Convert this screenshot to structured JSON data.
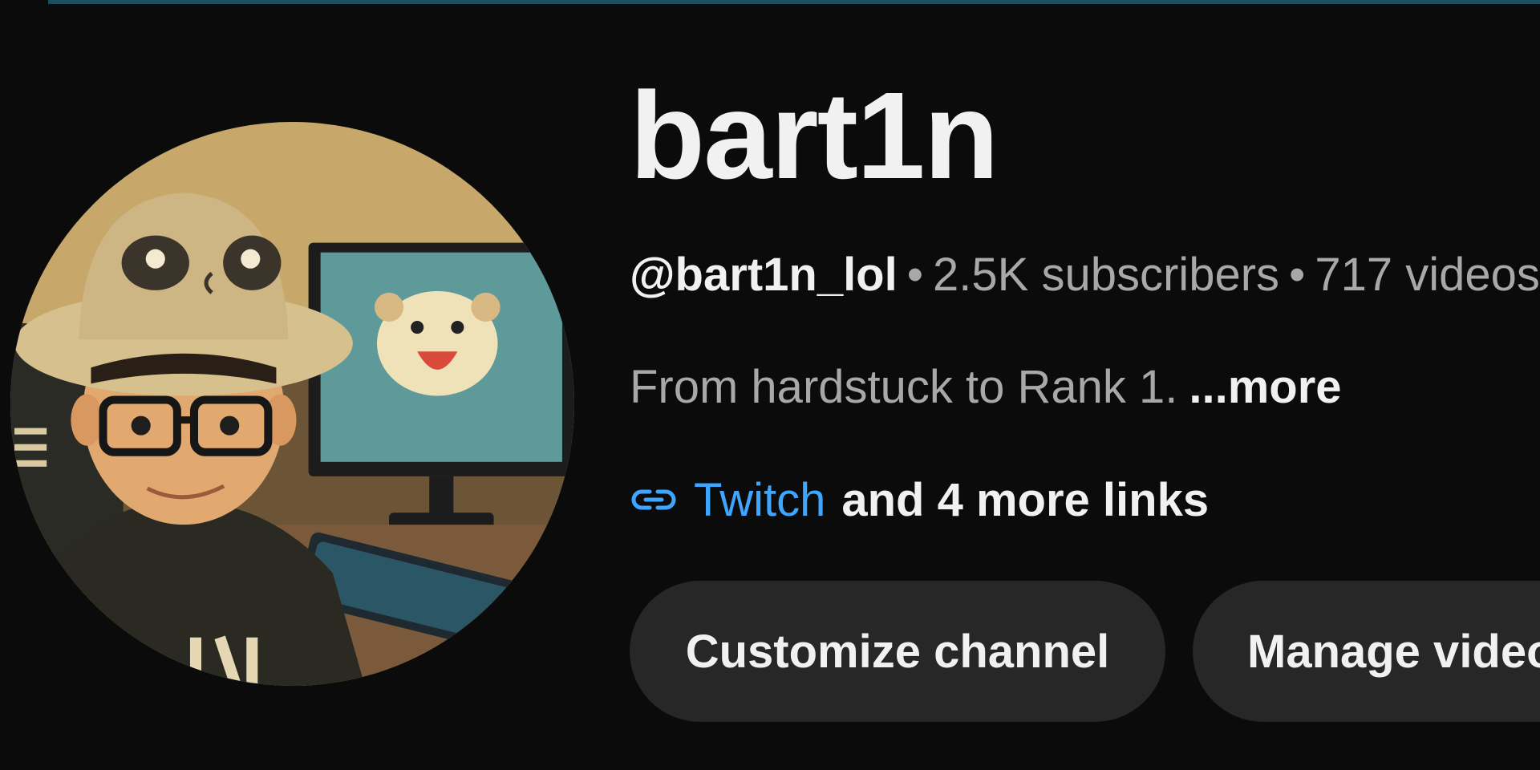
{
  "channel": {
    "name": "bart1n",
    "handle": "@bart1n_lol",
    "separator": "•",
    "subscribers": "2.5K subscribers",
    "videos": "717 videos",
    "description": "From hardstuck to Rank 1.",
    "more_label": "...more",
    "primary_link": "Twitch",
    "more_links_label": "and 4 more links"
  },
  "actions": {
    "customize_label": "Customize channel",
    "manage_label": "Manage videos"
  },
  "icons": {
    "link": "link-icon",
    "avatar": "channel-avatar"
  },
  "colors": {
    "background": "#0b0b0b",
    "link_blue": "#3ea6ff",
    "button_bg": "#272727",
    "secondary_text": "#a8a8a8",
    "primary_text": "#f1f1f1"
  }
}
